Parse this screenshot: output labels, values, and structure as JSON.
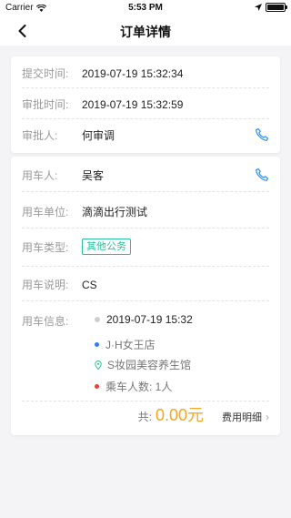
{
  "status": {
    "carrier": "Carrier",
    "time": "5:53 PM"
  },
  "nav": {
    "title": "订单详情"
  },
  "approval": {
    "submit_label": "提交时间:",
    "submit_value": "2019-07-19 15:32:34",
    "approve_label": "审批时间:",
    "approve_value": "2019-07-19 15:32:59",
    "approver_label": "审批人:",
    "approver_value": "何审调"
  },
  "order": {
    "user_label": "用车人:",
    "user_value": "吴客",
    "unit_label": "用车单位:",
    "unit_value": "滴滴出行测试",
    "type_label": "用车类型:",
    "type_value": "其他公务",
    "note_label": "用车说明:",
    "note_value": "CS",
    "info_label": "用车信息:",
    "info_time": "2019-07-19 15:32",
    "info_from": "J·H女王店",
    "info_to": "S妆园美容养生馆",
    "info_passengers": "乘车人数: 1人",
    "total_label": "共:",
    "total_amount": "0.00元",
    "detail_link": "费用明细"
  },
  "colors": {
    "accent": "#2bc29b",
    "amount": "#f5a623",
    "phone": "#2f8df3"
  }
}
